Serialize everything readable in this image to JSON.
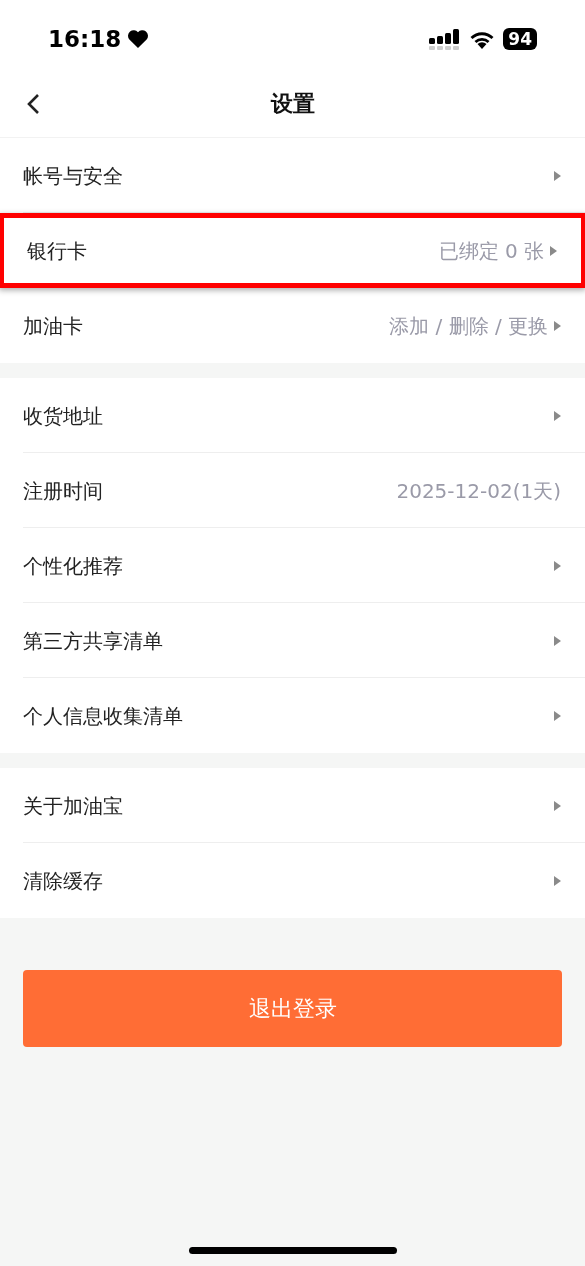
{
  "status_bar": {
    "time": "16:18",
    "battery": "94"
  },
  "nav": {
    "title": "设置"
  },
  "groups": [
    {
      "items": [
        {
          "label": "帐号与安全",
          "highlighted": false,
          "chevron": true
        },
        {
          "label": "银行卡",
          "value": "已绑定 0 张",
          "highlighted": true,
          "chevron": true
        },
        {
          "label": "加油卡",
          "value": "添加 / 删除 / 更换",
          "highlighted": false,
          "chevron": true
        }
      ]
    },
    {
      "items": [
        {
          "label": "收货地址",
          "highlighted": false,
          "chevron": true
        },
        {
          "label": "注册时间",
          "value": "2025-12-02(1天)",
          "highlighted": false,
          "chevron": false
        },
        {
          "label": "个性化推荐",
          "highlighted": false,
          "chevron": true
        },
        {
          "label": "第三方共享清单",
          "highlighted": false,
          "chevron": true
        },
        {
          "label": "个人信息收集清单",
          "highlighted": false,
          "chevron": true
        }
      ]
    },
    {
      "items": [
        {
          "label": "关于加油宝",
          "highlighted": false,
          "chevron": true
        },
        {
          "label": "清除缓存",
          "highlighted": false,
          "chevron": true
        }
      ]
    }
  ],
  "logout_button": "退出登录"
}
